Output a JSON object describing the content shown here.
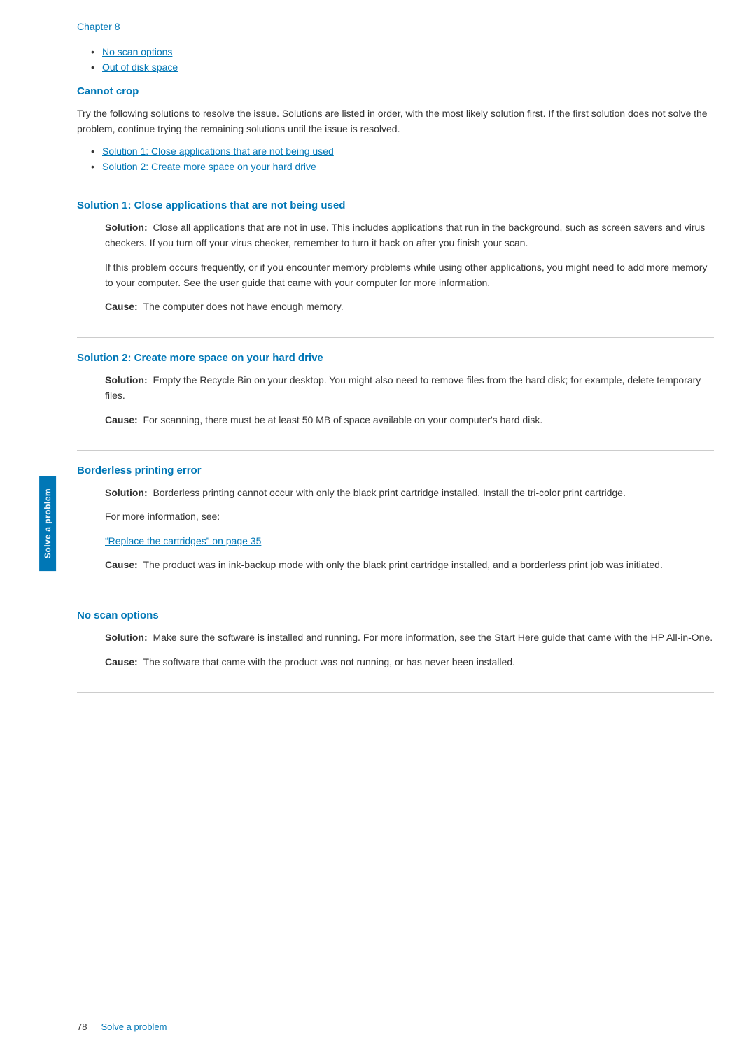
{
  "chapter": {
    "label": "Chapter 8"
  },
  "side_tab": {
    "label": "Solve a problem"
  },
  "toc_links": [
    {
      "text": "No scan options",
      "href": "#no-scan-options"
    },
    {
      "text": "Out of disk space",
      "href": "#out-of-disk-space"
    }
  ],
  "cannot_crop": {
    "heading": "Cannot crop",
    "intro": "Try the following solutions to resolve the issue. Solutions are listed in order, with the most likely solution first. If the first solution does not solve the problem, continue trying the remaining solutions until the issue is resolved.",
    "solution_links": [
      {
        "text": "Solution 1: Close applications that are not being used",
        "href": "#sol1"
      },
      {
        "text": "Solution 2: Create more space on your hard drive",
        "href": "#sol2"
      }
    ]
  },
  "solution1": {
    "heading": "Solution 1: Close applications that are not being used",
    "solution_label": "Solution:",
    "solution_text": "Close all applications that are not in use. This includes applications that run in the background, such as screen savers and virus checkers. If you turn off your virus checker, remember to turn it back on after you finish your scan.",
    "extra_text": "If this problem occurs frequently, or if you encounter memory problems while using other applications, you might need to add more memory to your computer. See the user guide that came with your computer for more information.",
    "cause_label": "Cause:",
    "cause_text": "The computer does not have enough memory."
  },
  "solution2": {
    "heading": "Solution 2: Create more space on your hard drive",
    "solution_label": "Solution:",
    "solution_text": "Empty the Recycle Bin on your desktop. You might also need to remove files from the hard disk; for example, delete temporary files.",
    "cause_label": "Cause:",
    "cause_text": "For scanning, there must be at least 50 MB of space available on your computer's hard disk."
  },
  "borderless": {
    "heading": "Borderless printing error",
    "solution_label": "Solution:",
    "solution_text": "Borderless printing cannot occur with only the black print cartridge installed. Install the tri-color print cartridge.",
    "for_more_label": "For more information, see:",
    "link_text": "“Replace the cartridges” on page 35",
    "link_href": "#replace-cartridges",
    "cause_label": "Cause:",
    "cause_text": "The product was in ink-backup mode with only the black print cartridge installed, and a borderless print job was initiated."
  },
  "no_scan_options": {
    "heading": "No scan options",
    "solution_label": "Solution:",
    "solution_text": "Make sure the software is installed and running. For more information, see the Start Here guide that came with the HP All-in-One.",
    "cause_label": "Cause:",
    "cause_text": "The software that came with the product was not running, or has never been installed."
  },
  "footer": {
    "page_number": "78",
    "chapter_label": "Solve a problem"
  }
}
